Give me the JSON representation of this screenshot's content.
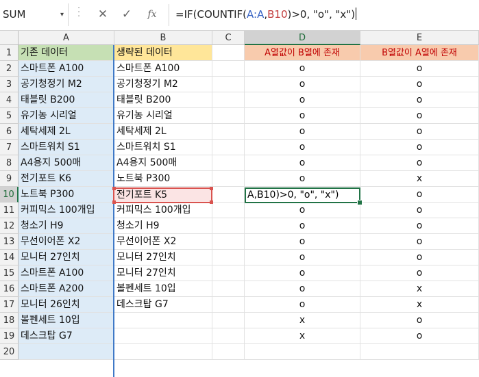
{
  "namebox": {
    "value": "SUM",
    "arrow": "▾"
  },
  "formula_bar": {
    "cancel": "✕",
    "enter": "✓",
    "fx": "fx",
    "f1": "=IF(COUNTIF(",
    "ref1": "A:A",
    "f2": ",",
    "ref2": "B10",
    "f3": ")>0, \"o\", \"x\")"
  },
  "columns": [
    "A",
    "B",
    "C",
    "D",
    "E"
  ],
  "rows": [
    "1",
    "2",
    "3",
    "4",
    "5",
    "6",
    "7",
    "8",
    "9",
    "10",
    "11",
    "12",
    "13",
    "14",
    "15",
    "16",
    "17",
    "18",
    "19",
    "20"
  ],
  "header": {
    "a": "기존 데이터",
    "b": "생략된 데이터",
    "d": "A열값이 B열에 존재",
    "e": "B열값이 A열에 존재"
  },
  "colors": {
    "header_a_bg": "#c6e0b4",
    "header_b_bg": "#ffe699",
    "header_de_bg": "#f8cbad",
    "header_de_text": "#c00000",
    "col_a_fill": "#ddebf7",
    "active_border": "#217346"
  },
  "col_a": [
    "스마트폰 A100",
    "공기청정기 M2",
    "태블릿 B200",
    "유기농 시리얼",
    "세탁세제 2L",
    "스마트워치 S1",
    "A4용지 500매",
    "전기포트 K6",
    "노트북 P300",
    "커피믹스 100개입",
    "청소기 H9",
    "무선이어폰 X2",
    "모니터 27인치",
    "스마트폰 A100",
    "스마트폰 A200",
    "모니터 26인치",
    "볼펜세트 10입",
    "데스크탑 G7",
    ""
  ],
  "col_b": [
    "스마트폰 A100",
    "공기청정기 M2",
    "태블릿 B200",
    "유기농 시리얼",
    "세탁세제 2L",
    "스마트워치 S1",
    "A4용지 500매",
    "노트북 P300",
    "전기포트 K5",
    "커피믹스 100개입",
    "청소기 H9",
    "무선이어폰 X2",
    "모니터 27인치",
    "모니터 27인치",
    "볼펜세트 10입",
    "데스크탑 G7",
    "",
    "",
    ""
  ],
  "col_d": [
    "o",
    "o",
    "o",
    "o",
    "o",
    "o",
    "o",
    "o",
    "",
    "o",
    "o",
    "o",
    "o",
    "o",
    "o",
    "o",
    "x",
    "x",
    ""
  ],
  "col_e": [
    "o",
    "o",
    "o",
    "o",
    "o",
    "o",
    "o",
    "x",
    "o",
    "o",
    "o",
    "o",
    "o",
    "o",
    "x",
    "x",
    "o",
    "o",
    ""
  ],
  "editing_text": "A,B10)>0, \"o\", \"x\")"
}
